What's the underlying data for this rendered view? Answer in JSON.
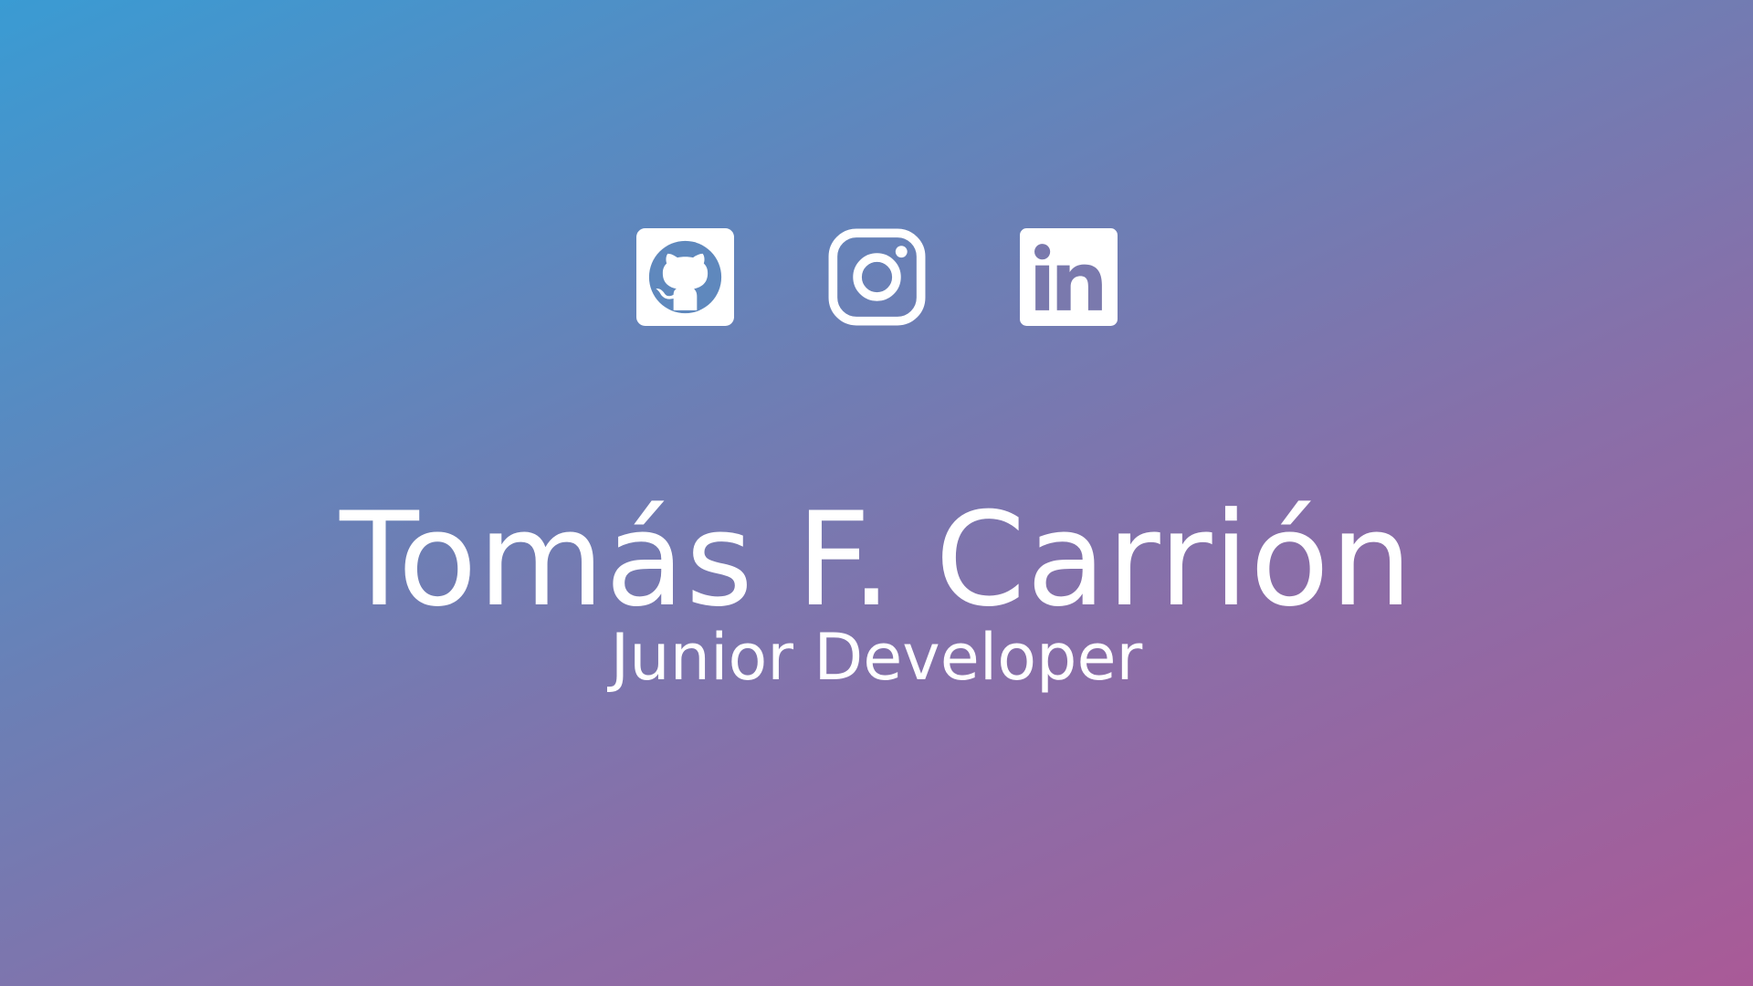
{
  "profile": {
    "name": "Tomás F. Carrión",
    "role": "Junior Developer"
  },
  "socials": [
    {
      "network": "GitHub",
      "icon": "github-icon"
    },
    {
      "network": "Instagram",
      "icon": "instagram-icon"
    },
    {
      "network": "LinkedIn",
      "icon": "linkedin-icon"
    }
  ],
  "colors": {
    "gradient_start": "#3a9bd3",
    "gradient_end": "#a95a97",
    "text": "#ffffff"
  }
}
